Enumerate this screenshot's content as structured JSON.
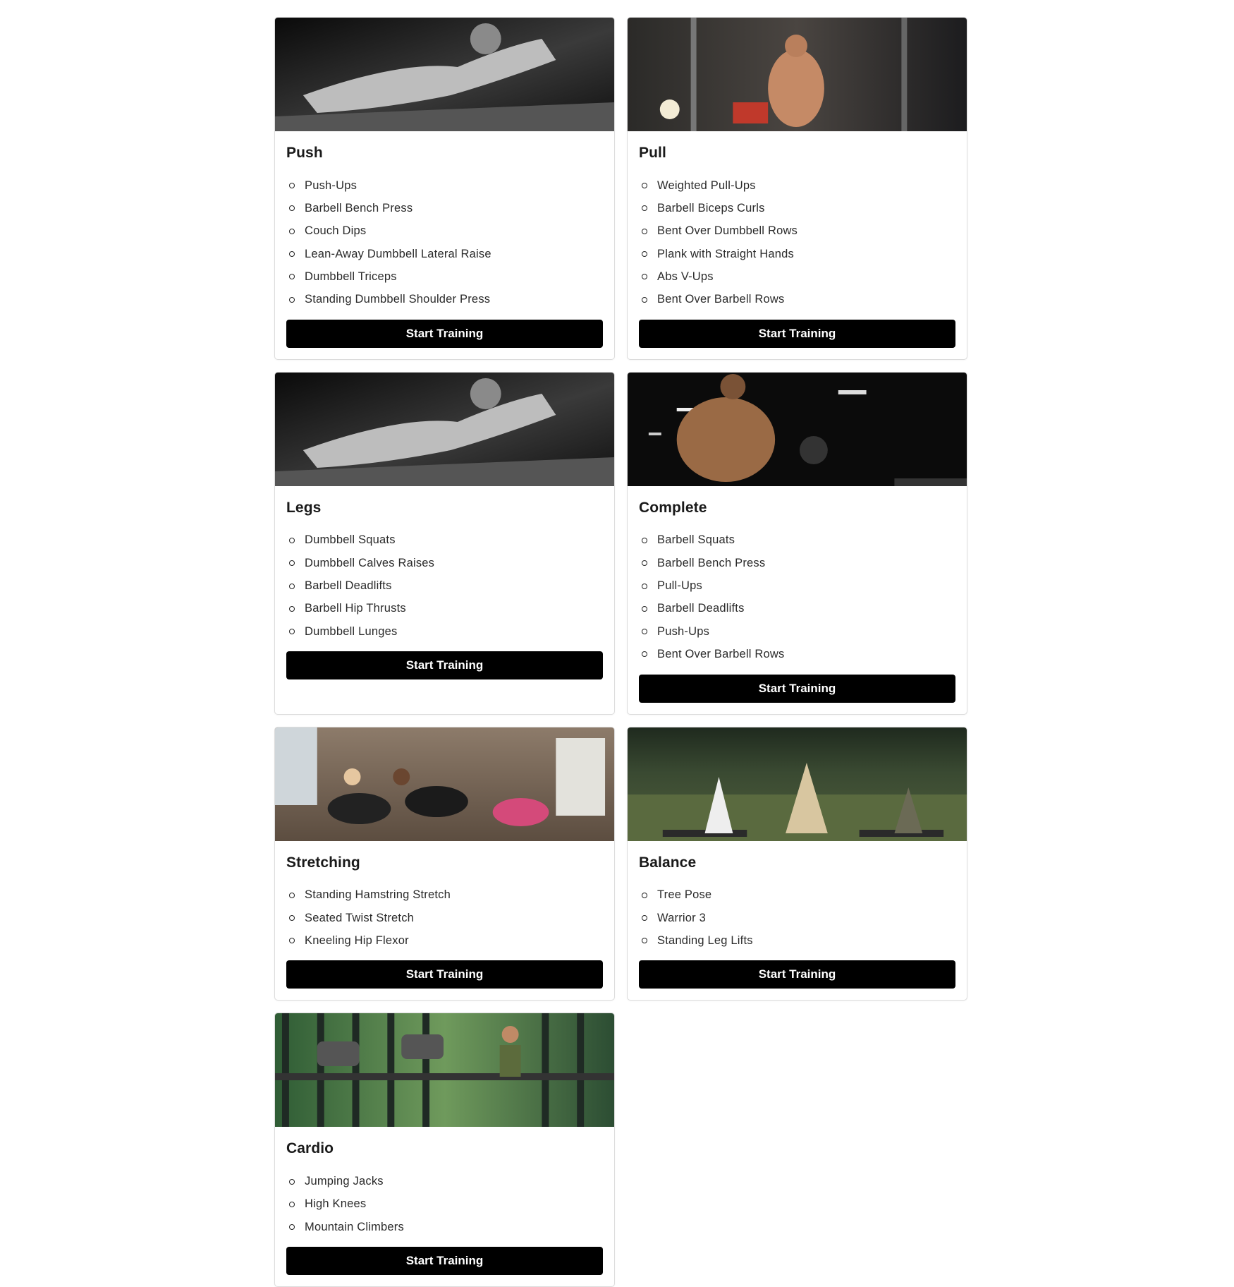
{
  "workouts": [
    {
      "title": "Push",
      "image": "push-workout-photo",
      "tone": "bw",
      "exercises": [
        "Push-Ups",
        "Barbell Bench Press",
        "Couch Dips",
        "Lean-Away Dumbbell Lateral Raise",
        "Dumbbell Triceps",
        "Standing Dumbbell Shoulder Press"
      ],
      "button_label": "Start Training"
    },
    {
      "title": "Pull",
      "image": "pull-workout-photo",
      "tone": "warm",
      "exercises": [
        "Weighted Pull-Ups",
        "Barbell Biceps Curls",
        "Bent Over Dumbbell Rows",
        "Plank with Straight Hands",
        "Abs V-Ups",
        "Bent Over Barbell Rows"
      ],
      "button_label": "Start Training"
    },
    {
      "title": "Legs",
      "image": "legs-workout-photo",
      "tone": "bw",
      "exercises": [
        "Dumbbell Squats",
        "Dumbbell Calves Raises",
        "Barbell Deadlifts",
        "Barbell Hip Thrusts",
        "Dumbbell Lunges"
      ],
      "button_label": "Start Training"
    },
    {
      "title": "Complete",
      "image": "complete-workout-photo",
      "tone": "dark",
      "exercises": [
        "Barbell Squats",
        "Barbell Bench Press",
        "Pull-Ups",
        "Barbell Deadlifts",
        "Push-Ups",
        "Bent Over Barbell Rows"
      ],
      "button_label": "Start Training"
    },
    {
      "title": "Stretching",
      "image": "stretching-workout-photo",
      "tone": "brick",
      "exercises": [
        "Standing Hamstring Stretch",
        "Seated Twist Stretch",
        "Kneeling Hip Flexor"
      ],
      "button_label": "Start Training"
    },
    {
      "title": "Balance",
      "image": "balance-workout-photo",
      "tone": "park",
      "exercises": [
        "Tree Pose",
        "Warrior 3",
        "Standing Leg Lifts"
      ],
      "button_label": "Start Training"
    },
    {
      "title": "Cardio",
      "image": "cardio-workout-photo",
      "tone": "gym",
      "exercises": [
        "Jumping Jacks",
        "High Knees",
        "Mountain Climbers"
      ],
      "button_label": "Start Training"
    }
  ],
  "colors": {
    "button_bg": "#000000",
    "button_text": "#ffffff",
    "card_border": "#dcdcdc"
  }
}
